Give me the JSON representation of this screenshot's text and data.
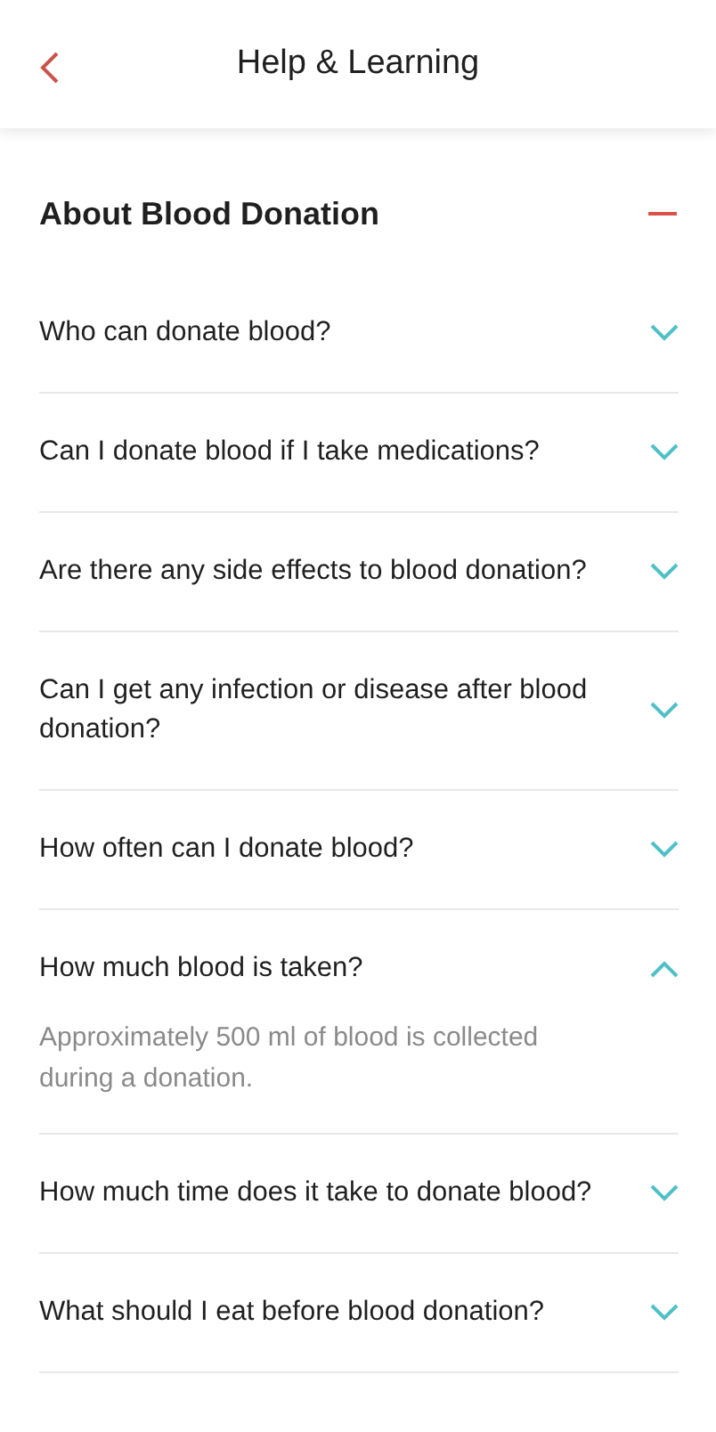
{
  "header": {
    "title": "Help & Learning"
  },
  "section": {
    "title": "About Blood Donation",
    "expanded": true,
    "items": [
      {
        "question": "Who can donate blood?",
        "expanded": false
      },
      {
        "question": "Can I donate blood if I take medications?",
        "expanded": false
      },
      {
        "question": "Are there any side effects to blood donation?",
        "expanded": false
      },
      {
        "question": "Can I get any infection or disease after blood donation?",
        "expanded": false
      },
      {
        "question": "How often can I donate blood?",
        "expanded": false
      },
      {
        "question": "How much blood is taken?",
        "expanded": true,
        "answer": "Approximately 500 ml of blood is collected during a donation."
      },
      {
        "question": "How much time does it take to donate blood?",
        "expanded": false
      },
      {
        "question": "What should I eat before blood donation?",
        "expanded": false
      }
    ]
  }
}
